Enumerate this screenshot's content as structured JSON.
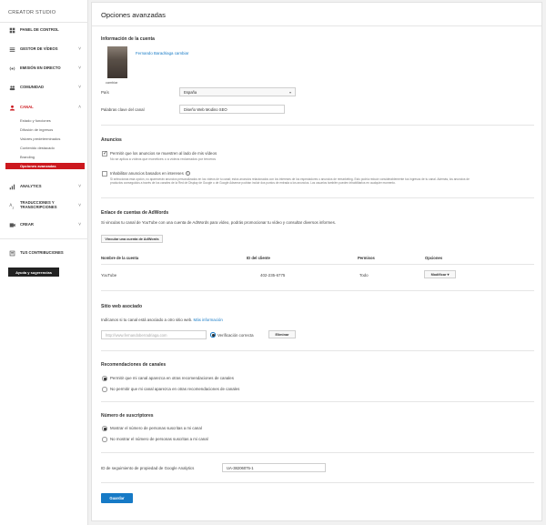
{
  "sidebar": {
    "studio_title": "CREATOR STUDIO",
    "items": [
      {
        "label": "PANEL DE CONTROL",
        "icon": "dashboard-icon"
      },
      {
        "label": "GESTOR DE VÍDEOS",
        "icon": "video-manager-icon",
        "chevron": "˅"
      },
      {
        "label": "EMISIÓN EN DIRECTO",
        "icon": "live-icon",
        "chevron": "˅"
      },
      {
        "label": "COMUNIDAD",
        "icon": "community-icon",
        "chevron": "˅"
      },
      {
        "label": "CANAL",
        "icon": "channel-icon",
        "chevron": "˄"
      }
    ],
    "channel_sub": [
      "Estado y funciones",
      "Difusión de ingresos",
      "Valores predeterminados",
      "Contenido destacado",
      "Branding"
    ],
    "active_sub": "Opciones avanzadas",
    "lower_items": [
      {
        "label": "ANALYTICS",
        "icon": "analytics-icon",
        "chevron": "˅"
      },
      {
        "label_line1": "TRADUCCIONES Y",
        "label_line2": "TRANSCRIPCIONES",
        "icon": "translate-icon",
        "chevron": "˅"
      },
      {
        "label": "CREAR",
        "icon": "create-icon",
        "chevron": "˅"
      }
    ],
    "contributions": "TUS CONTRIBUCIONES",
    "help": "Ayuda y sugerencias"
  },
  "main": {
    "title": "Opciones avanzadas",
    "account": {
      "section_title": "Información de la cuenta",
      "user_name": "Fernando Baradriaga",
      "change_link": "cambiar",
      "avatar_caption": "cambiar",
      "country_label": "País",
      "country_value": "España",
      "keywords_label": "Palabras clave del canal",
      "keywords_value": "Diseño Web Modino SEO"
    },
    "ads": {
      "section_title": "Anuncios",
      "opt1": "Permitir que los anuncios se muestren al lado de mis vídeos",
      "opt1_note": "No se aplica a vídeos que monetices o a vídeos reclamados por terceros",
      "opt2": "Inhabilitar anuncios basados en intereses",
      "opt2_note": "Si seleccionas esta opción, no aparecerán anuncios personalizados en los vídeos de tu canal; estos anuncios relacionados con los intereses de los espectadores o anuncios de remarketing. Esto podría reducir considerablemente tus ingresos de tu canal. Además, los anuncios de productos conseguidos a través de los canales de la Red de Display de Google o de Google Adsense podrían incluir dos puntos de entrada a los anuncios. Los usuarios también pueden inhabilitarlos en cualquier momento."
    },
    "adwords": {
      "section_title": "Enlace de cuentas de AdWords",
      "description": "Si vinculas tu canal de YouTube con una cuenta de AdWords para vídeo, podrás promocionar tu vídeo y consultar diversos informes.",
      "link_button": "Vincular una cuenta de AdWords",
      "headers": [
        "Nombre de la cuenta",
        "ID del cliente",
        "Permisos",
        "Opciones"
      ],
      "rows": [
        {
          "name": "YouTube",
          "id": "402-235-6775",
          "perm": "Todo",
          "option": "Modificar"
        }
      ]
    },
    "website": {
      "section_title": "Sitio web asociado",
      "description": "Indícanos si tu canal está asociado a otro sitio web.",
      "more_link": "Más información",
      "url_placeholder": "http://www.fernandoberradriaga.com",
      "verify_text": "Verificación correcta",
      "delete_button": "Eliminar"
    },
    "recommend": {
      "section_title": "Recomendaciones de canales",
      "opt1": "Permitir que mi canal aparezca en otras recomendaciones de canales",
      "opt2": "No permitir que mi canal aparezca en otras recomendaciones de canales"
    },
    "subscribers": {
      "section_title": "Número de suscriptores",
      "opt1": "Mostrar el número de personas suscritas a mi canal",
      "opt2": "No mostrar el número de personas suscritas a mi canal"
    },
    "analytics": {
      "label": "ID de seguimiento de propiedad de Google Analytics",
      "value": "UA-38206075-1"
    },
    "save_button": "Guardar"
  },
  "colors": {
    "accent": "#cc181e",
    "link": "#167ac6",
    "save": "#167ac6"
  }
}
